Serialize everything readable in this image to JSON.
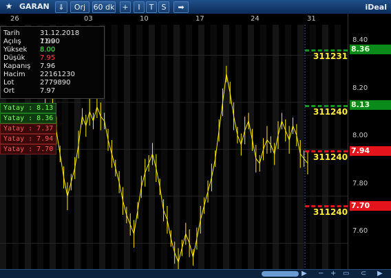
{
  "toolbar": {
    "star": "★",
    "symbol": "GARAN",
    "buttons": [
      "⇓",
      "Orj",
      "60 dk",
      "+",
      "I",
      "T",
      "S",
      "➡"
    ],
    "brand": "iDeal"
  },
  "date_axis": [
    "26",
    "03",
    "10",
    "17",
    "24",
    "31"
  ],
  "price_axis": [
    "8.40",
    "8.20",
    "8.00",
    "7.80",
    "7.60"
  ],
  "info_panel": {
    "rows": [
      {
        "label": "Tarih",
        "value": "31.12.2018 11:00",
        "color": "#e8e8e8"
      },
      {
        "label": "Açılış",
        "value": "7.99",
        "color": "#e8e8e8"
      },
      {
        "label": "Yüksek",
        "value": "8.00",
        "color": "#55ff55"
      },
      {
        "label": "Düşük",
        "value": "7.95",
        "color": "#ff4040"
      },
      {
        "label": "Kapanış",
        "value": "7.96",
        "color": "#e8e8e8"
      },
      {
        "label": "Hacim",
        "value": "22161230",
        "color": "#e8e8e8"
      },
      {
        "label": "Lot",
        "value": "2779890",
        "color": "#e8e8e8"
      },
      {
        "label": "Ort",
        "value": "7.97",
        "color": "#e8e8e8"
      }
    ]
  },
  "horizontal_tags": [
    {
      "text": "Yatay : 8.13",
      "color": "green"
    },
    {
      "text": "Yatay : 8.36",
      "color": "green"
    },
    {
      "text": "Yatay : 7.37",
      "color": "red"
    },
    {
      "text": "Yatay : 7.94",
      "color": "red"
    },
    {
      "text": "Yatay : 7.70",
      "color": "red"
    }
  ],
  "price_badges": [
    {
      "value": "8.36",
      "color": "green"
    },
    {
      "value": "8.13",
      "color": "green"
    },
    {
      "value": "7.94",
      "color": "red"
    },
    {
      "value": "7.70",
      "color": "red"
    }
  ],
  "line_date_labels": [
    "311231",
    "311240",
    "311240",
    "311240"
  ],
  "chart_data": {
    "type": "line",
    "xlabel": "",
    "ylabel": "",
    "ylim": [
      7.49,
      8.53
    ],
    "x_tick_labels": [
      "26",
      "03",
      "10",
      "17",
      "24",
      "31"
    ],
    "y_ticks": [
      8.4,
      8.2,
      8.0,
      7.8,
      7.6
    ],
    "series": [
      {
        "values": [
          8.05,
          8.12,
          8.18,
          8.1,
          8.2,
          8.08,
          7.98,
          7.88,
          7.8,
          7.86,
          7.92,
          8.02,
          8.14,
          8.1,
          8.16,
          8.12,
          8.18,
          8.14,
          8.12,
          8.04,
          7.98,
          7.92,
          7.86,
          7.78,
          7.72,
          7.68,
          7.64,
          7.74,
          7.84,
          7.9,
          7.94,
          7.98,
          7.92,
          7.84,
          7.74,
          7.7,
          7.62,
          7.56,
          7.52,
          7.58,
          7.64,
          7.6,
          7.54,
          7.62,
          7.7,
          7.76,
          7.82,
          7.88,
          7.96,
          8.08,
          8.2,
          8.32,
          8.24,
          8.14,
          8.06,
          8.02,
          8.08,
          8.12,
          8.04,
          7.96,
          7.94,
          8.0,
          8.04,
          8.02,
          7.98,
          8.06,
          8.12,
          8.08,
          8.04,
          8.1,
          8.06,
          7.98,
          7.96,
          7.94
        ]
      }
    ],
    "horizontal_levels": [
      8.36,
      8.13,
      7.94,
      7.7,
      7.37
    ],
    "grid": true
  }
}
